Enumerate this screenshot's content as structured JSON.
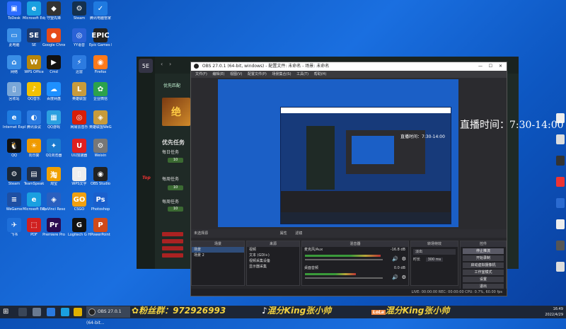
{
  "desktop": {
    "icons": [
      {
        "label": "ToDesk",
        "color": "#2b6cff",
        "glyph": "▣"
      },
      {
        "label": "Microsoft Edge",
        "color": "#1aa0e0",
        "glyph": "e"
      },
      {
        "label": "守望先锋",
        "color": "#333",
        "glyph": "◆"
      },
      {
        "label": "Steam",
        "color": "#14304e",
        "glyph": "⚙"
      },
      {
        "label": "腾讯电脑管家",
        "color": "#1f7ae0",
        "glyph": "✓"
      },
      {
        "label": "此电脑",
        "color": "#3a8ee6",
        "glyph": "▭"
      },
      {
        "label": "SE",
        "color": "#1c3a6e",
        "glyph": "SE"
      },
      {
        "label": "Google Chrome",
        "color": "#e64a19",
        "glyph": "●"
      },
      {
        "label": "YY语音",
        "color": "#2a62d6",
        "glyph": "◎"
      },
      {
        "label": "Epic Games Launcher",
        "color": "#222",
        "glyph": "EPIC"
      },
      {
        "label": "网络",
        "color": "#3a8ee6",
        "glyph": "⌂"
      },
      {
        "label": "WPS Office",
        "color": "#b8860b",
        "glyph": "W"
      },
      {
        "label": "Cmd",
        "color": "#111",
        "glyph": "▶"
      },
      {
        "label": "迅雷",
        "color": "#2d7be0",
        "glyph": "⚡"
      },
      {
        "label": "Firefox",
        "color": "#ff7a1a",
        "glyph": "◉"
      },
      {
        "label": "回收站",
        "color": "#7aa7d8",
        "glyph": "▯"
      },
      {
        "label": "QQ音乐",
        "color": "#f2c100",
        "glyph": "♪"
      },
      {
        "label": "百度网盘",
        "color": "#1e90ff",
        "glyph": "☁"
      },
      {
        "label": "英雄联盟",
        "color": "#c89b3c",
        "glyph": "L"
      },
      {
        "label": "企业微信",
        "color": "#2ca24c",
        "glyph": "✿"
      },
      {
        "label": "Internet Explorer",
        "color": "#1e7be0",
        "glyph": "e"
      },
      {
        "label": "腾讯会议",
        "color": "#2a7ae0",
        "glyph": "◐"
      },
      {
        "label": "QQ游戏",
        "color": "#2ca0e0",
        "glyph": "▦"
      },
      {
        "label": "网易云音乐",
        "color": "#d81e06",
        "glyph": "◎"
      },
      {
        "label": "英雄联盟WeGame",
        "color": "#c89b3c",
        "glyph": "◈"
      },
      {
        "label": "QQ",
        "color": "#111",
        "glyph": "🐧"
      },
      {
        "label": "向日葵",
        "color": "#f09a00",
        "glyph": "☀"
      },
      {
        "label": "QQ浏览器",
        "color": "#1a7ad0",
        "glyph": "✦"
      },
      {
        "label": "UU加速器",
        "color": "#e02020",
        "glyph": "U"
      },
      {
        "label": "Weixin",
        "color": "#777",
        "glyph": "⚙"
      },
      {
        "label": "Steam",
        "color": "#1b2838",
        "glyph": "⚙"
      },
      {
        "label": "TeamSpeak",
        "color": "#20304a",
        "glyph": "▤"
      },
      {
        "label": "淘宝",
        "color": "#f0a000",
        "glyph": "淘"
      },
      {
        "label": "WPS文字",
        "color": "#eeeeee",
        "glyph": "▯"
      },
      {
        "label": "OBS Studio",
        "color": "#222",
        "glyph": "◉"
      },
      {
        "label": "WeGame",
        "color": "#1e4fa3",
        "glyph": "≡"
      },
      {
        "label": "Microsoft Edge",
        "color": "#1aa0e0",
        "glyph": "e"
      },
      {
        "label": "DaVinci Resolve",
        "color": "#2a5fbf",
        "glyph": "◈"
      },
      {
        "label": "CSGO",
        "color": "#f0a010",
        "glyph": "GO"
      },
      {
        "label": "Photoshop",
        "color": "#1a5fcc",
        "glyph": "Ps"
      },
      {
        "label": "飞书",
        "color": "#1e6fd9",
        "glyph": "✈"
      },
      {
        "label": "PDF",
        "color": "#d02020",
        "glyph": "⬚"
      },
      {
        "label": "Premiere Pro",
        "color": "#2a0a50",
        "glyph": "Pr"
      },
      {
        "label": "Logitech G HUB",
        "color": "#111",
        "glyph": "G"
      },
      {
        "label": "PowerPoint",
        "color": "#d04a1a",
        "glyph": "P"
      }
    ]
  },
  "launcher": {
    "logo_text": "5E",
    "nav_primary": "优先匹配",
    "banner_text": "绝",
    "section_title": "优先任务",
    "tasks": [
      {
        "label": "每日任务",
        "badge": "10"
      },
      {
        "label": "每周任务",
        "badge": "10"
      },
      {
        "label": "每周任务",
        "badge": "10"
      }
    ],
    "gadget_label": "Top"
  },
  "obs": {
    "title": "OBS 27.0.1 (64-bit, windows) - 配置文件: 未命名 - 场景: 未命名",
    "menu": [
      "文件(F)",
      "编辑(E)",
      "视图(V)",
      "配置文件(P)",
      "场景集合(S)",
      "工具(T)",
      "帮助(H)"
    ],
    "toolbar_scene_label": "未选择源",
    "scene_buttons": [
      "属性",
      "滤镜"
    ],
    "docks": {
      "scenes": {
        "title": "场景",
        "items": [
          "场景",
          "场景 2"
        ]
      },
      "sources": {
        "title": "来源",
        "items": [
          "视频",
          "文本 (GDI+)",
          "视频采集设备",
          "显示器采集"
        ]
      },
      "mixer": {
        "title": "混音器",
        "channels": [
          {
            "name": "麦克风/Aux",
            "db": "-16.8 dB",
            "level": 0.82
          },
          {
            "name": "桌面音频",
            "db": "0.0 dB",
            "level": 0.55
          }
        ]
      },
      "transitions": {
        "title": "转场特效",
        "type": "淡出",
        "duration_label": "时长",
        "duration_value": "300 ms"
      },
      "controls": {
        "title": "控件",
        "buttons": [
          "停止推流",
          "开始录制",
          "启动虚拟摄像机",
          "工作室模式",
          "设置",
          "退出"
        ]
      }
    },
    "status": "LIVE: 00:00:00    REC: 00:00:00    CPU: 0.7%, 60.00 fps"
  },
  "live_time": "直播时间：7:30-14:00",
  "taskbar": {
    "obs_task": "OBS 27.0.1 (64-bit...",
    "promo_fans": "粉丝群：972926993",
    "promo_douyin": "混分King张小帅",
    "promo_kuaishou": "混分King张小帅",
    "time": "16:49",
    "date": "2022/4/29"
  }
}
